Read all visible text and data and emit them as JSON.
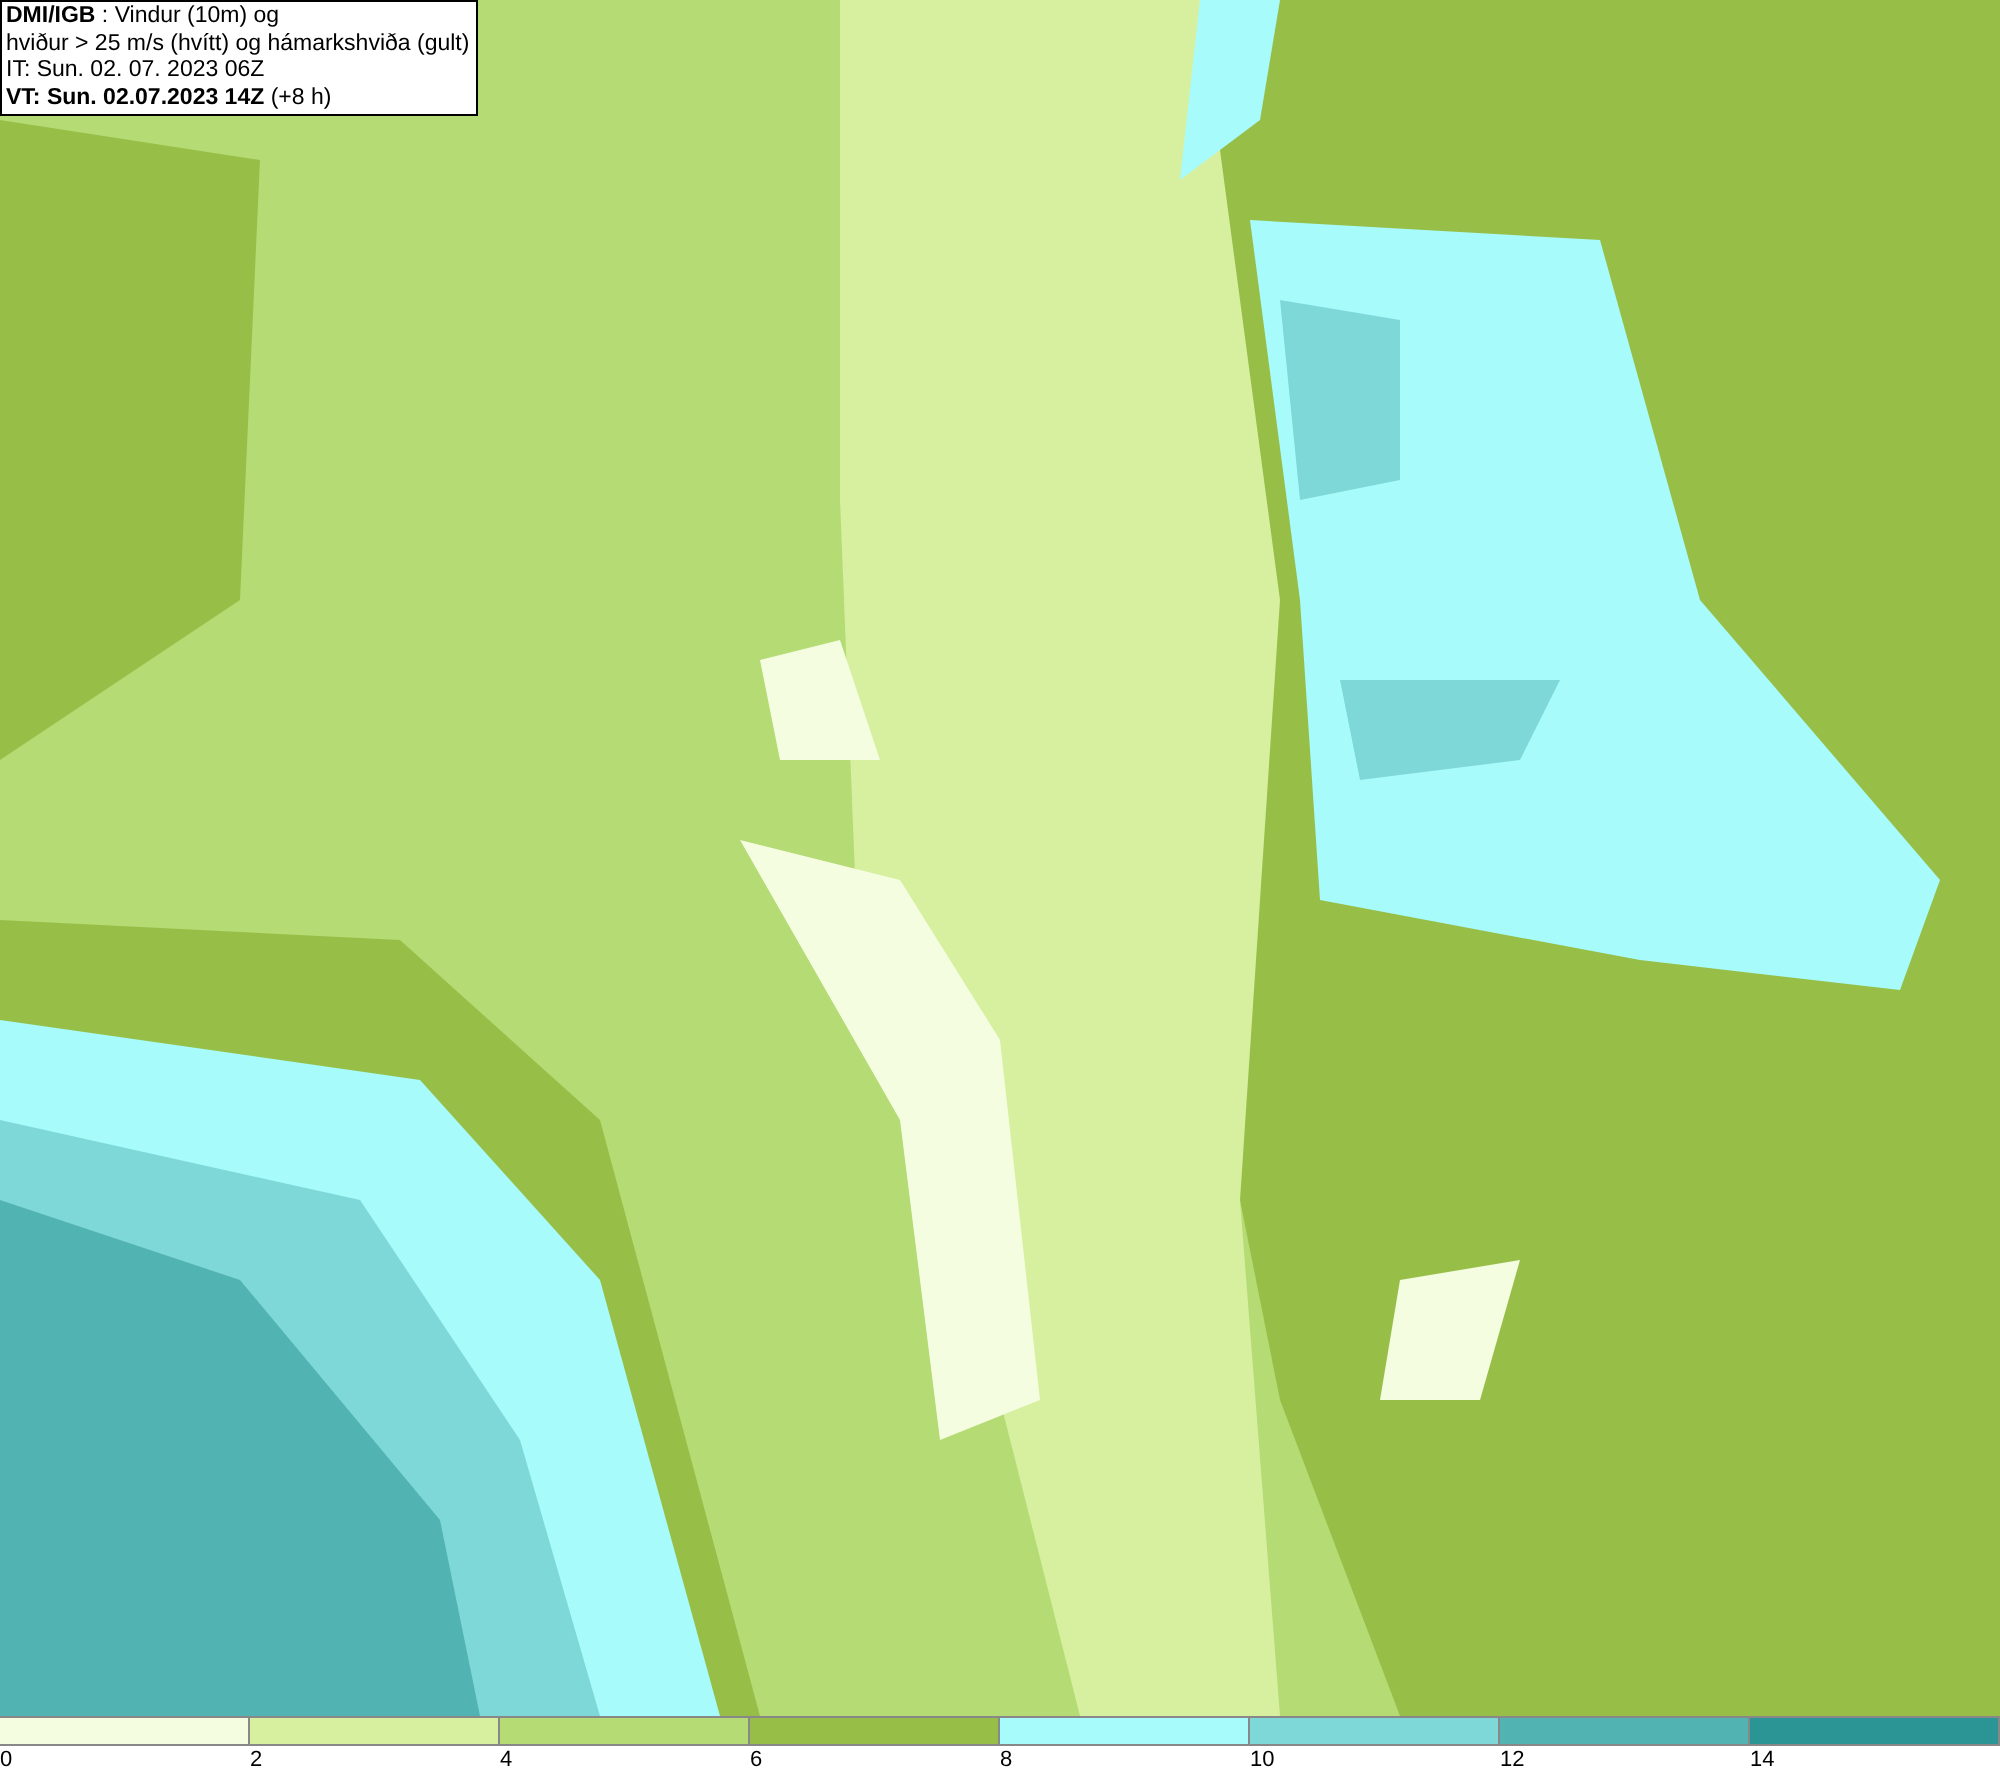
{
  "info_box": {
    "lines": [
      "**DMI/IGB** : Vindur (10m) og",
      "hviður > 25 m/s (hvítt) og hámarkshviða (gult)",
      "IT: Sun. 02. 07. 2023 06Z",
      "**VT: Sun. 02.07.2023 14Z** (+8 h)"
    ]
  },
  "legend": {
    "bins": [
      {
        "color": "#f4fde0"
      },
      {
        "color": "#d6f0a0"
      },
      {
        "color": "#b5db75"
      },
      {
        "color": "#97bf48"
      },
      {
        "color": "#a8fbfb"
      },
      {
        "color": "#7fd8d8"
      },
      {
        "color": "#52b3b3"
      },
      {
        "color": "#2b9494"
      }
    ],
    "ticks": [
      "0",
      "2",
      "4",
      "6",
      "8",
      "10",
      "12",
      "14"
    ]
  }
}
